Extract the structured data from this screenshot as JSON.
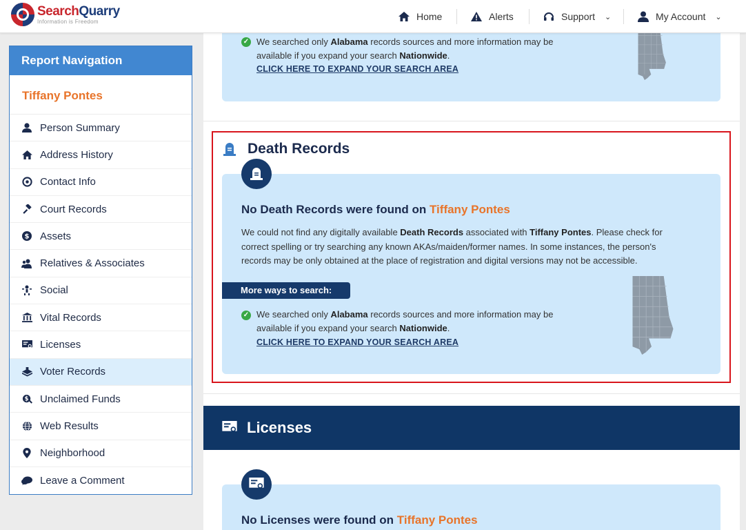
{
  "header": {
    "logo_name_part1": "Search",
    "logo_name_part2": "Quarry",
    "logo_tagline": "Information is Freedom",
    "nav": {
      "home": "Home",
      "alerts": "Alerts",
      "support": "Support",
      "account": "My Account"
    }
  },
  "sidebar": {
    "title": "Report Navigation",
    "person_name": "Tiffany Pontes",
    "items": [
      {
        "label": "Person Summary",
        "icon": "person-icon"
      },
      {
        "label": "Address History",
        "icon": "home-icon"
      },
      {
        "label": "Contact Info",
        "icon": "at-phone-icon"
      },
      {
        "label": "Court Records",
        "icon": "gavel-icon"
      },
      {
        "label": "Assets",
        "icon": "dollar-icon"
      },
      {
        "label": "Relatives & Associates",
        "icon": "people-icon"
      },
      {
        "label": "Social",
        "icon": "social-icon"
      },
      {
        "label": "Vital Records",
        "icon": "bank-icon"
      },
      {
        "label": "Licenses",
        "icon": "certificate-icon"
      },
      {
        "label": "Voter Records",
        "icon": "ballot-icon"
      },
      {
        "label": "Unclaimed Funds",
        "icon": "money-search-icon"
      },
      {
        "label": "Web Results",
        "icon": "globe-icon"
      },
      {
        "label": "Neighborhood",
        "icon": "map-pin-icon"
      },
      {
        "label": "Leave a Comment",
        "icon": "comment-icon"
      }
    ],
    "active_item": "Voter Records"
  },
  "top_card": {
    "search_prefix": "We searched only ",
    "state": "Alabama",
    "search_middle": " records sources and more information may be",
    "search_line2_prefix": "available if you expand your search ",
    "nationwide": "Nationwide",
    "search_line2_suffix": ".",
    "expand_link": "CLICK HERE TO EXPAND YOUR SEARCH AREA"
  },
  "death_records": {
    "section_title": "Death Records",
    "heading_prefix": "No Death Records were found on ",
    "heading_name": "Tiffany Pontes",
    "desc_1": "We could not find any digitally available ",
    "desc_bold_1": "Death Records",
    "desc_2": " associated with ",
    "desc_bold_name": "Tiffany Pontes",
    "desc_3": ". Please check for correct spelling or try searching any known AKAs/maiden/former names. In some instances, the person's records may be only obtained at the place of registration and digital versions may not be accessible.",
    "more_ways": "More ways to search:",
    "search_prefix": "We searched only ",
    "state": "Alabama",
    "search_middle": " records sources and more information may be",
    "search_line2_prefix": "available if you expand your search ",
    "nationwide": "Nationwide",
    "search_line2_suffix": ".",
    "expand_link": "CLICK HERE TO EXPAND YOUR SEARCH AREA"
  },
  "licenses": {
    "section_title": "Licenses",
    "heading_prefix": "No Licenses were found on ",
    "heading_name": "Tiffany Pontes"
  },
  "colors": {
    "accent_orange": "#e8742a",
    "navy": "#163a6b",
    "light_blue": "#cfe8fb",
    "highlight_red": "#d8141b"
  }
}
